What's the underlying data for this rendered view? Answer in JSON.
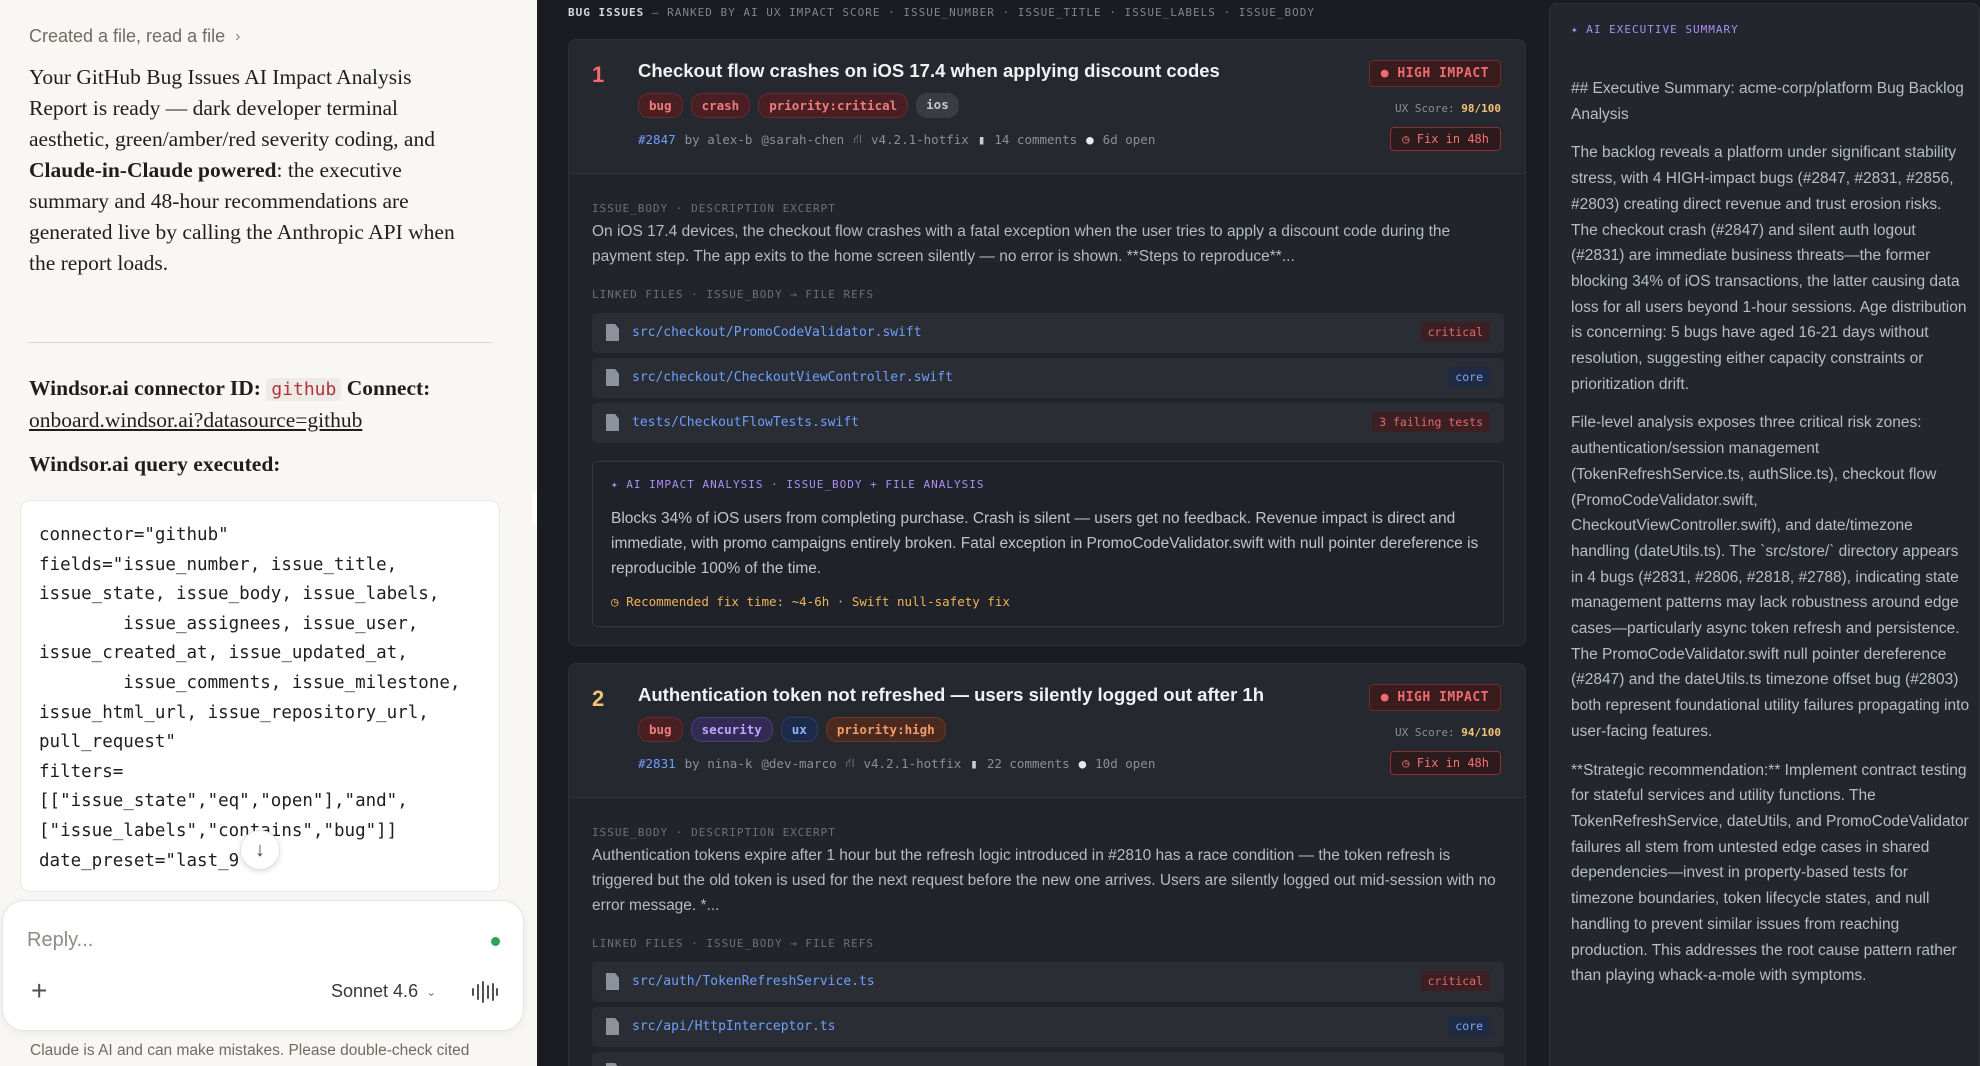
{
  "chat": {
    "created_file": "Created a file, read a file",
    "intro_pre": "Your GitHub Bug Issues AI Impact Analysis Report is ready — dark developer terminal aesthetic, green/amber/red severity coding, and ",
    "intro_bold": "Claude-in-Claude powered",
    "intro_post": ": the executive summary and 48-hour recommendations are generated live by calling the Anthropic API when the report loads.",
    "connector_label": "Windsor.ai connector ID:",
    "connector_id": "github",
    "connect_label": "Connect:",
    "connect_link": "onboard.windsor.ai?datasource=github",
    "query_title": "Windsor.ai query executed:",
    "query_code": "connector=\"github\"\nfields=\"issue_number, issue_title,\nissue_state, issue_body, issue_labels,\n        issue_assignees, issue_user,\nissue_created_at, issue_updated_at,\n        issue_comments, issue_milestone,\nissue_html_url, issue_repository_url,\npull_request\"\nfilters=\n[[\"issue_state\",\"eq\",\"open\"],\"and\",\n[\"issue_labels\",\"contains\",\"bug\"]]\ndate_preset=\"last_9",
    "reply_placeholder": "Reply...",
    "model": "Sonnet 4.6",
    "disclaimer": "Claude is AI and can make mistakes. Please double-check cited"
  },
  "issues": {
    "header_title": "BUG ISSUES",
    "header_rest": " — RANKED BY AI UX IMPACT SCORE · ISSUE_NUMBER · ISSUE_TITLE · ISSUE_LABELS · ISSUE_BODY",
    "section_body": "ISSUE_BODY · DESCRIPTION EXCERPT",
    "section_files": "LINKED FILES · ISSUE_BODY → FILE REFS",
    "cards": [
      {
        "rank": "1",
        "title": "Checkout flow crashes on iOS 17.4 when applying discount codes",
        "labels": [
          {
            "text": "bug",
            "style": "red"
          },
          {
            "text": "crash",
            "style": "red"
          },
          {
            "text": "priority:critical",
            "style": "red"
          },
          {
            "text": "ios",
            "style": "gray"
          }
        ],
        "number": "#2847",
        "by": "by alex-b",
        "assignee": "@sarah-chen",
        "milestone": "v4.2.1-hotfix",
        "comments": "14 comments",
        "open": "6d open",
        "impact": "HIGH IMPACT",
        "score_label": "UX Score: ",
        "score": "98/100",
        "fix": "Fix in 48h",
        "body": "On iOS 17.4 devices, the checkout flow crashes with a fatal exception when the user tries to apply a discount code during the payment step. The app exits to the home screen silently — no error is shown. **Steps to reproduce**...",
        "files": [
          {
            "path": "src/checkout/PromoCodeValidator.swift",
            "badge": "critical",
            "badge_style": "critical"
          },
          {
            "path": "src/checkout/CheckoutViewController.swift",
            "badge": "core",
            "badge_style": "core"
          },
          {
            "path": "tests/CheckoutFlowTests.swift",
            "badge": "3 failing tests",
            "badge_style": "failing"
          }
        ],
        "analysis_label": "✦ AI IMPACT ANALYSIS · ISSUE_BODY + FILE ANALYSIS",
        "analysis": "Blocks 34% of iOS users from completing purchase. Crash is silent — users get no feedback. Revenue impact is direct and immediate, with promo campaigns entirely broken. Fatal exception in PromoCodeValidator.swift with null pointer dereference is reproducible 100% of the time.",
        "recommendation": "Recommended fix time: ~4-6h · Swift null-safety fix"
      },
      {
        "rank": "2",
        "title": "Authentication token not refreshed — users silently logged out after 1h",
        "labels": [
          {
            "text": "bug",
            "style": "red"
          },
          {
            "text": "security",
            "style": "purple"
          },
          {
            "text": "ux",
            "style": "blue"
          },
          {
            "text": "priority:high",
            "style": "orange"
          }
        ],
        "number": "#2831",
        "by": "by nina-k",
        "assignee": "@dev-marco",
        "milestone": "v4.2.1-hotfix",
        "comments": "22 comments",
        "open": "10d open",
        "impact": "HIGH IMPACT",
        "score_label": "UX Score: ",
        "score": "94/100",
        "fix": "Fix in 48h",
        "body": "Authentication tokens expire after 1 hour but the refresh logic introduced in #2810 has a race condition — the token refresh is triggered but the old token is used for the next request before the new one arrives. Users are silently logged out mid-session with no error message. *...",
        "files": [
          {
            "path": "src/auth/TokenRefreshService.ts",
            "badge": "critical",
            "badge_style": "critical"
          },
          {
            "path": "src/api/HttpInterceptor.ts",
            "badge": "core",
            "badge_style": "core"
          }
        ]
      }
    ]
  },
  "summary": {
    "label": "✦ AI EXECUTIVE SUMMARY",
    "paragraphs": [
      "## Executive Summary: acme-corp/platform Bug Backlog Analysis",
      "The backlog reveals a platform under significant stability stress, with 4 HIGH-impact bugs (#2847, #2831, #2856, #2803) creating direct revenue and trust erosion risks. The checkout crash (#2847) and silent auth logout (#2831) are immediate business threats—the former blocking 34% of iOS transactions, the latter causing data loss for all users beyond 1-hour sessions. Age distribution is concerning: 5 bugs have aged 16-21 days without resolution, suggesting either capacity constraints or prioritization drift.",
      "File-level analysis exposes three critical risk zones: authentication/session management (TokenRefreshService.ts, authSlice.ts), checkout flow (PromoCodeValidator.swift, CheckoutViewController.swift), and date/timezone handling (dateUtils.ts). The `src/store/` directory appears in 4 bugs (#2831, #2806, #2818, #2788), indicating state management patterns may lack robustness around edge cases—particularly async token refresh and persistence. The PromoCodeValidator.swift null pointer dereference (#2847) and the dateUtils.ts timezone offset bug (#2803) both represent foundational utility failures propagating into user-facing features.",
      "**Strategic recommendation:** Implement contract testing for stateful services and utility functions. The TokenRefreshService, dateUtils, and PromoCodeValidator failures all stem from untested edge cases in shared dependencies—invest in property-based tests for timezone boundaries, token lifecycle states, and null handling to prevent similar issues from reaching production. This addresses the root cause pattern rather than playing whack-a-mole with symptoms."
    ]
  },
  "colors": {
    "rank1": "#f36b6b",
    "rank2": "#f3c27a"
  }
}
